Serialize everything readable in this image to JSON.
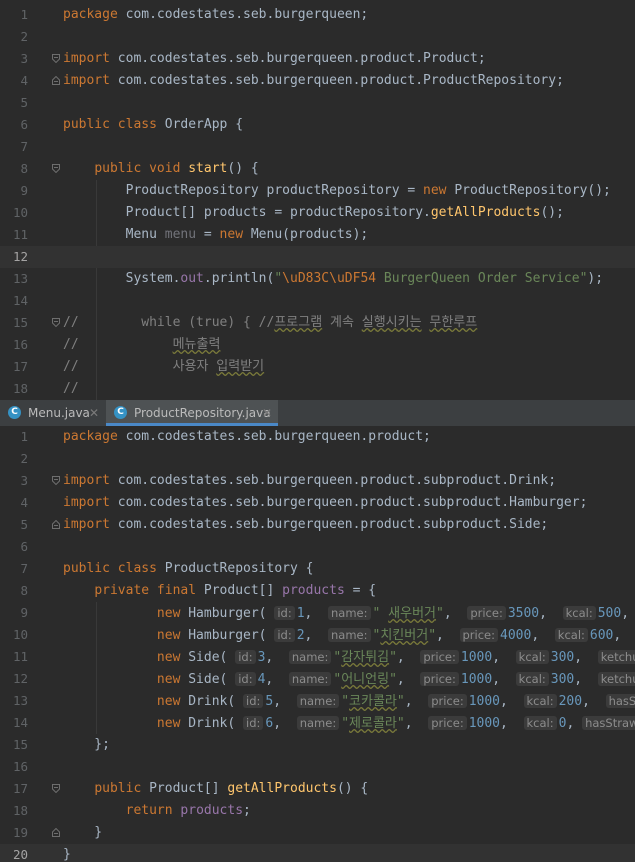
{
  "top_editor": {
    "line_numbers": [
      "1",
      "2",
      "3",
      "4",
      "5",
      "6",
      "7",
      "8",
      "9",
      "10",
      "11",
      "12",
      "13",
      "14",
      "15",
      "16",
      "17",
      "18"
    ]
  },
  "tabs": [
    {
      "label": "Menu.java",
      "icon": "C"
    },
    {
      "label": "ProductRepository.java",
      "icon": "C"
    }
  ],
  "bottom_editor": {
    "line_numbers": [
      "1",
      "2",
      "3",
      "4",
      "5",
      "6",
      "7",
      "8",
      "9",
      "10",
      "11",
      "12",
      "13",
      "14",
      "15",
      "16",
      "17",
      "18",
      "19",
      "20"
    ]
  },
  "colors": {
    "background": "#2b2b2b",
    "keyword": "#cc7832",
    "string": "#6a8759",
    "number": "#6897bb",
    "method": "#ffc66d",
    "field": "#9876aa",
    "comment": "#808080",
    "text": "#a9b7c6"
  }
}
